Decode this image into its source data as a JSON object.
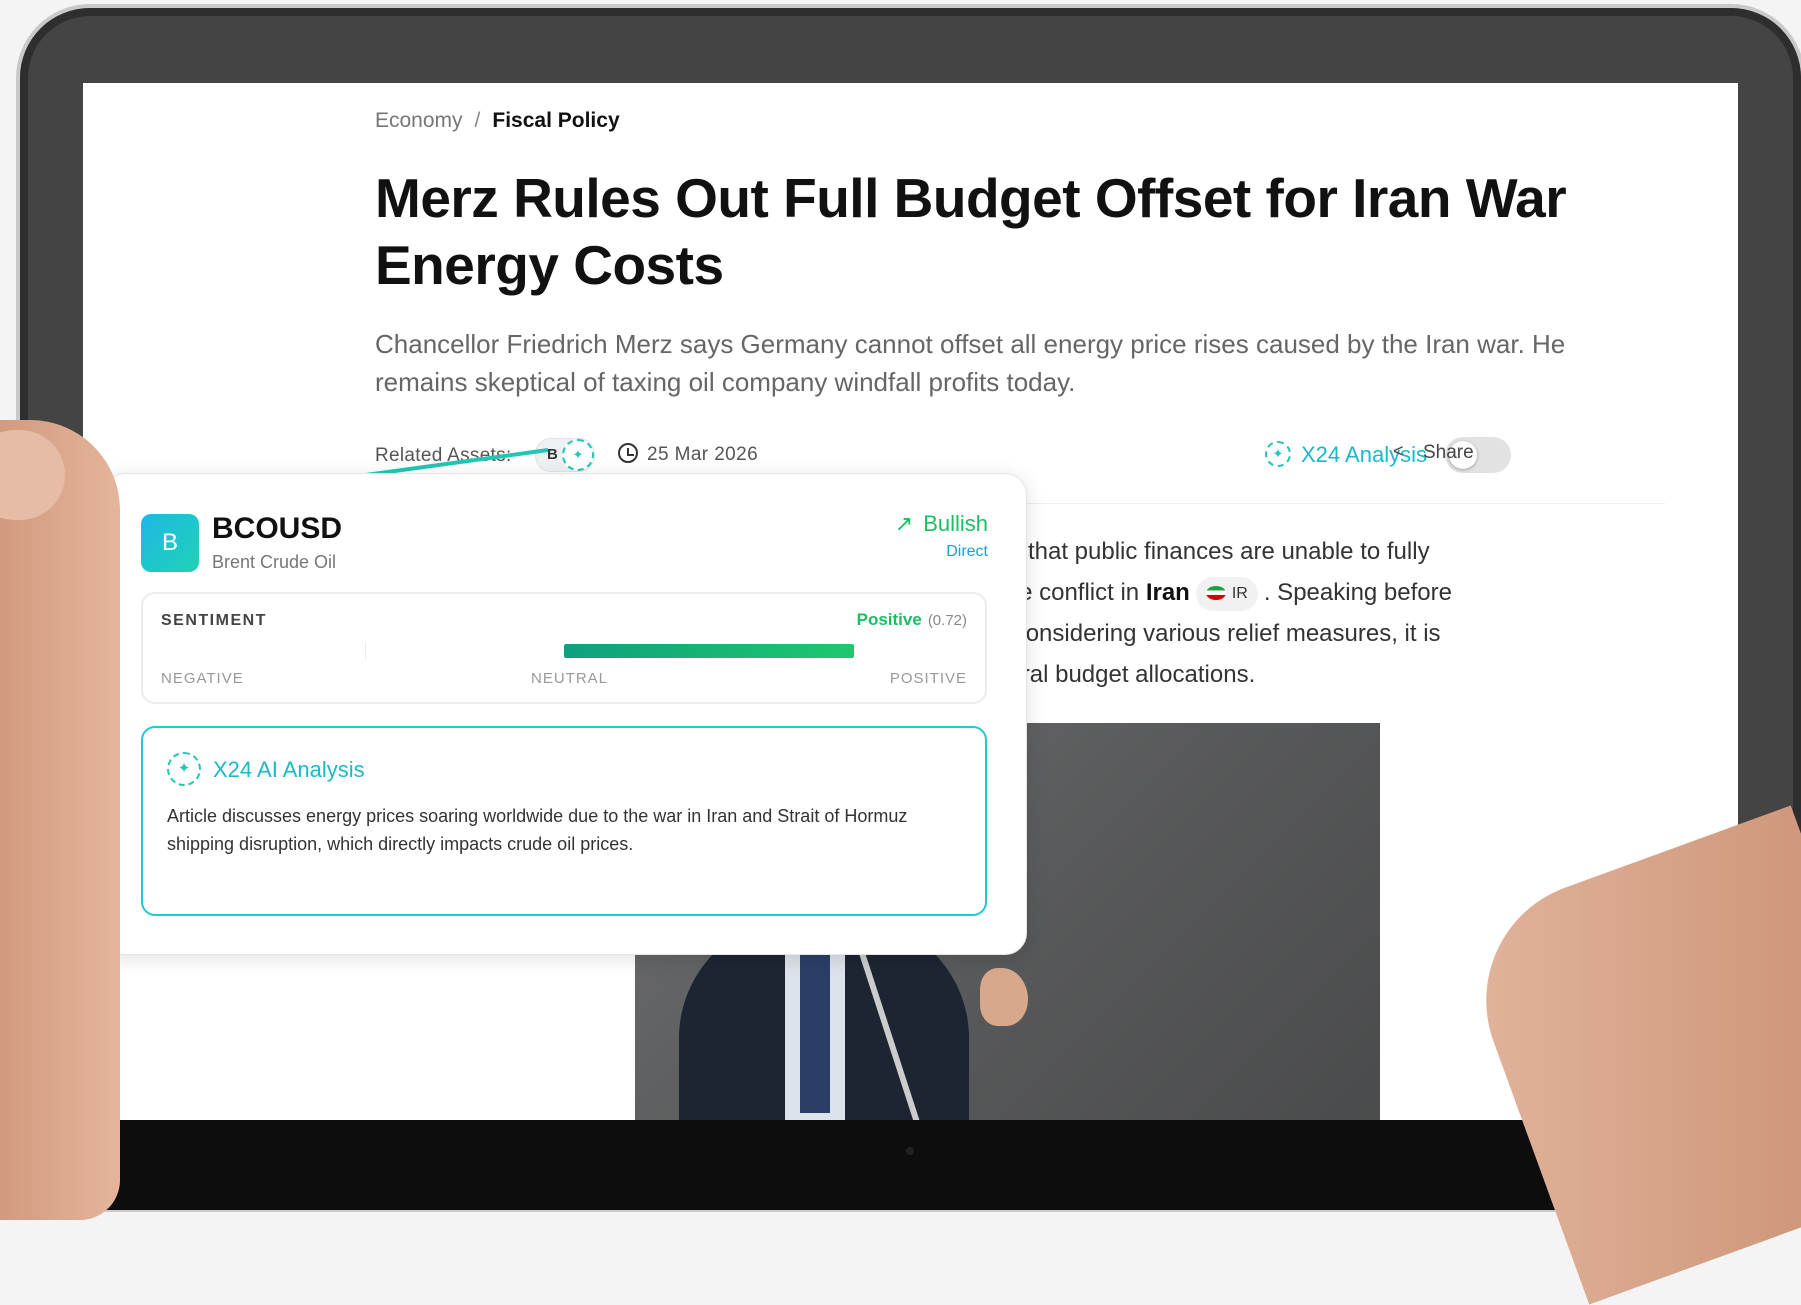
{
  "breadcrumb": {
    "section": "Economy",
    "separator": "/",
    "current": "Fiscal Policy"
  },
  "article": {
    "headline": "Merz Rules Out Full Budget Offset for Iran War Energy Costs",
    "subtitle": "Chancellor Friedrich Merz says Germany cannot offset all energy price rises caused by the Iran war. He remains skeptical of taxing oil company windfall profits today.",
    "related_assets_label": "Related Assets:",
    "asset_chip_letter": "B",
    "date": "25 Mar 2026",
    "x24_analysis_label": "X24 Analysis",
    "x24_toggle_on": false,
    "share_label": "Share",
    "body_lines": [
      "Wednesday that public finances are unable to fully",
      "aused by the conflict in",
      "ernment is considering various relief measures, it is",
      "ents or federal budget allocations."
    ],
    "body_line2_strong": "Iran",
    "body_line2_tail": ". Speaking before",
    "country_chip": "IR"
  },
  "popup": {
    "badge_letter": "B",
    "symbol": "BCOUSD",
    "name": "Brent Crude Oil",
    "signal": "Bullish",
    "signal_type": "Direct",
    "sentiment": {
      "title": "SENTIMENT",
      "label": "Positive",
      "score": "(0.72)",
      "score_value": 0.72,
      "scale_negative": "NEGATIVE",
      "scale_neutral": "NEUTRAL",
      "scale_positive": "POSITIVE"
    },
    "ai": {
      "title": "X24 AI Analysis",
      "text": "Article discusses energy prices soaring worldwide due to the war in Iran and Strait of Hormuz shipping disruption, which directly impacts crude oil prices."
    }
  },
  "colors": {
    "accent_teal": "#21c7b3",
    "accent_blue": "#1cb8c9",
    "positive_green": "#1bbf63",
    "direct_blue": "#1aa0e0"
  },
  "icons": {
    "clock": "clock-icon",
    "share": "share-icon",
    "ai": "ai-sparkle-icon",
    "trend": "trending-up-icon"
  }
}
